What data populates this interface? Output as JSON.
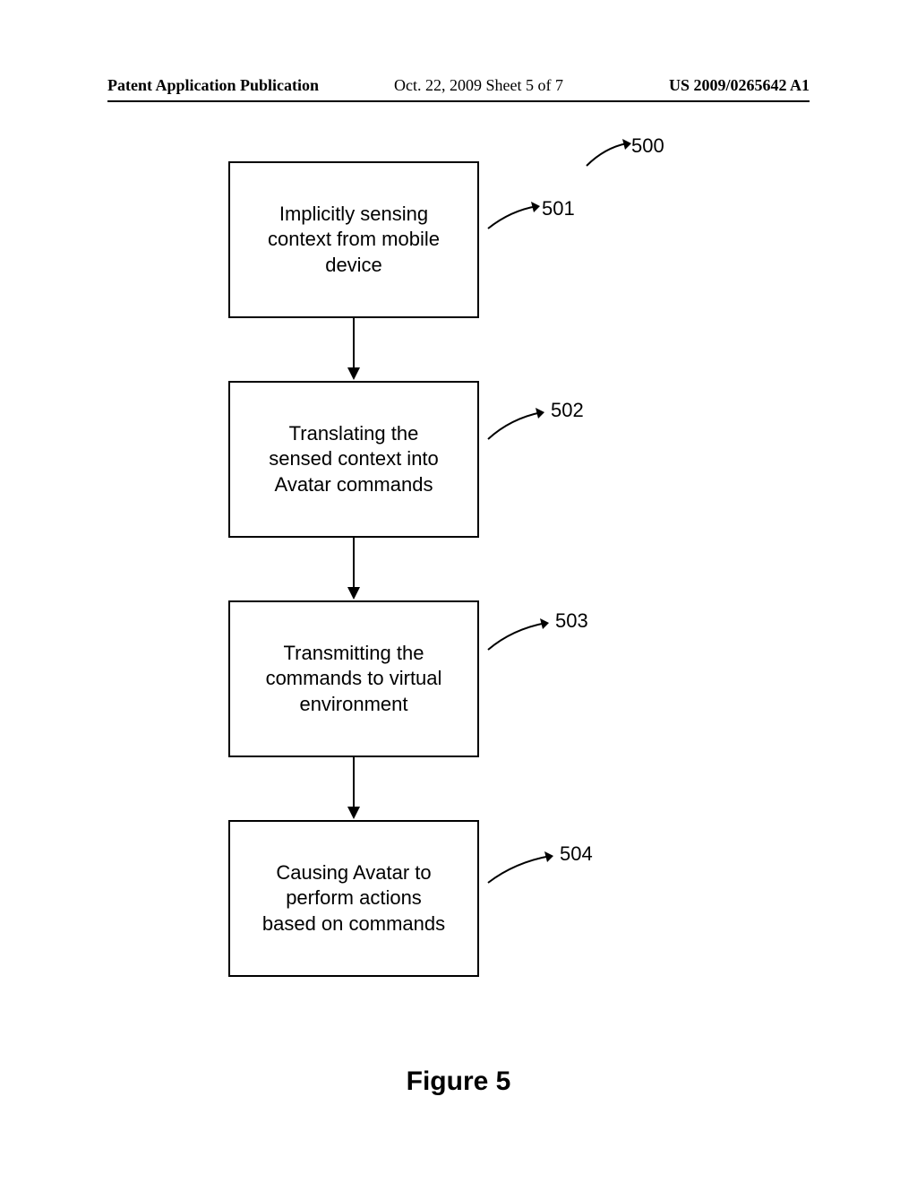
{
  "header": {
    "left": "Patent Application Publication",
    "center": "Oct. 22, 2009  Sheet 5 of 7",
    "right": "US 2009/0265642 A1"
  },
  "chart_data": {
    "type": "flowchart",
    "overall_ref": "500",
    "nodes": [
      {
        "id": "501",
        "text": "Implicitly sensing context from mobile device"
      },
      {
        "id": "502",
        "text": "Translating the sensed context into Avatar commands"
      },
      {
        "id": "503",
        "text": "Transmitting the commands to virtual environment"
      },
      {
        "id": "504",
        "text": "Causing Avatar to perform actions based on commands"
      }
    ],
    "edges": [
      {
        "from": "501",
        "to": "502"
      },
      {
        "from": "502",
        "to": "503"
      },
      {
        "from": "503",
        "to": "504"
      }
    ]
  },
  "caption": "Figure 5"
}
